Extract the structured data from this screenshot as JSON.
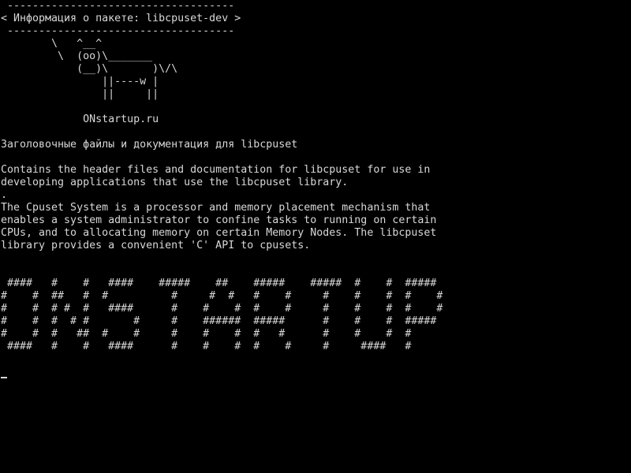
{
  "terminal": {
    "cowsay": {
      "top_border": " ------------------------------------",
      "message": "< Информация о пакете: libcpuset-dev >",
      "bottom_border": " ------------------------------------",
      "cow": [
        "        \\   ^__^",
        "         \\  (oo)\\_______",
        "            (__)\\       )\\/\\",
        "                ||----w |",
        "                ||     ||"
      ]
    },
    "site": "             ONstartup.ru",
    "summary": "Заголовочные файлы и документация для libcpuset",
    "description_1": [
      "Contains the header files and documentation for libcpuset for use in",
      "developing applications that use the libcpuset library."
    ],
    "separator": ".",
    "description_2": [
      "The Cpuset System is a processor and memory placement mechanism that",
      "enables a system administrator to confine tasks to running on certain",
      "CPUs, and to allocating memory on certain Memory Nodes. The libcpuset",
      "library provides a convenient 'C' API to cpusets."
    ],
    "banner": [
      " ####   #    #   ####    #####    ##    #####    #####  #    #  #####",
      "#    #  ##   #  #          #     #  #   #    #     #    #    #  #    #",
      "#    #  # #  #   ####      #    #    #  #    #     #    #    #  #    #",
      "#    #  #  # #       #     #    ######  #####      #    #    #  #####",
      "#    #  #   ##  #    #     #    #    #  #   #      #    #    #  #",
      " ####   #    #   ####      #    #    #  #    #     #     ####   #"
    ]
  }
}
